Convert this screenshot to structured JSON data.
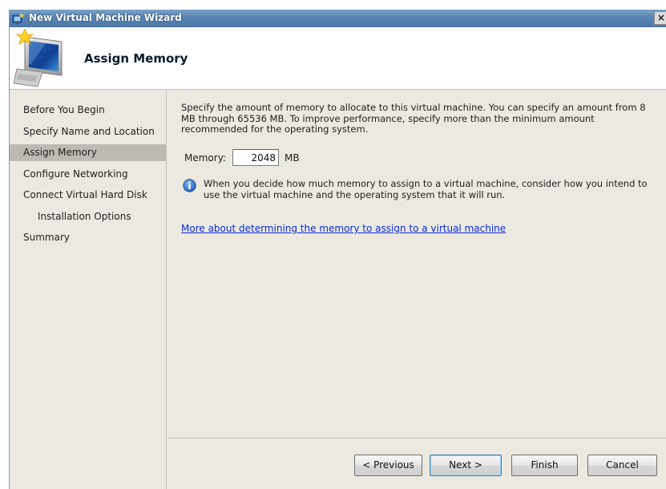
{
  "window": {
    "title": "New Virtual Machine Wizard",
    "close_glyph": "×"
  },
  "header": {
    "title": "Assign Memory",
    "icon": "wizard-monitor-icon"
  },
  "nav": {
    "items": [
      {
        "label": "Before You Begin",
        "active": false,
        "sub": false
      },
      {
        "label": "Specify Name and Location",
        "active": false,
        "sub": false
      },
      {
        "label": "Assign Memory",
        "active": true,
        "sub": false
      },
      {
        "label": "Configure Networking",
        "active": false,
        "sub": false
      },
      {
        "label": "Connect Virtual Hard Disk",
        "active": false,
        "sub": false
      },
      {
        "label": "Installation Options",
        "active": false,
        "sub": true
      },
      {
        "label": "Summary",
        "active": false,
        "sub": false
      }
    ]
  },
  "content": {
    "description": "Specify the amount of memory to allocate to this virtual machine. You can specify an amount from 8 MB through 65536 MB. To improve performance, specify more than the minimum amount recommended for the operating system.",
    "memory_label": "Memory:",
    "memory_value": "2048",
    "memory_unit": "MB",
    "info_text": "When you decide how much memory to assign to a virtual machine, consider how you intend to use the virtual machine and the operating system that it will run.",
    "info_icon": "info-icon",
    "link_text": "More about determining the memory to assign to a virtual machine"
  },
  "buttons": {
    "previous": "< Previous",
    "next": "Next >",
    "finish": "Finish",
    "cancel": "Cancel"
  },
  "colors": {
    "titlebar": "#5b86b4",
    "window_bg": "#ece9e1",
    "active_nav": "#bdbab2",
    "link": "#0a2bd6"
  }
}
